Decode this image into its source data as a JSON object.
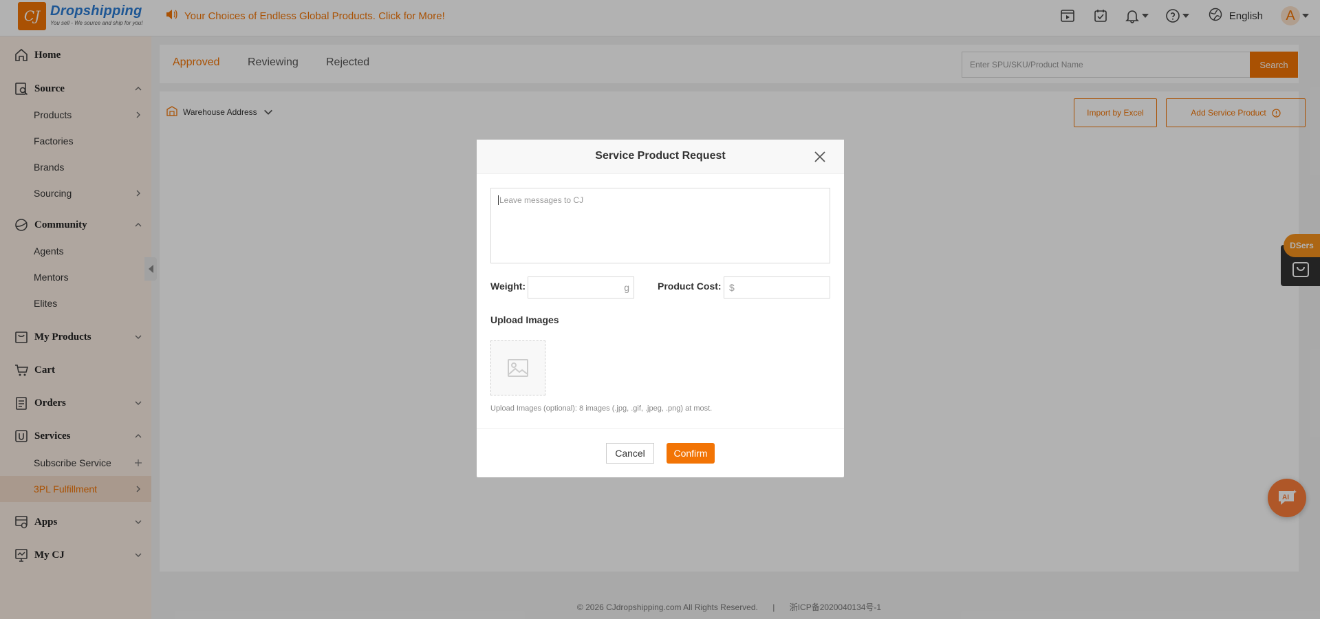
{
  "header": {
    "logo_text": "Dropshipping",
    "logo_mark": "CJ",
    "logo_tagline": "You sell - We source and ship for you!",
    "announcement": "Your Choices of Endless Global Products. Click for More!",
    "language": "English",
    "avatar_letter": "A",
    "icons": [
      "video-icon",
      "task-check-icon",
      "bell-icon",
      "help-icon",
      "globe-icon"
    ]
  },
  "sidebar": {
    "groups": [
      {
        "label": "Home",
        "icon": "home-icon"
      },
      {
        "label": "Source",
        "icon": "source-icon",
        "expanded": true,
        "items": [
          "Products",
          "Factories",
          "Brands",
          "Sourcing"
        ]
      },
      {
        "label": "Community",
        "icon": "community-icon",
        "expanded": true,
        "items": [
          "Agents",
          "Mentors",
          "Elites"
        ]
      },
      {
        "label": "My Products",
        "icon": "my-products-icon"
      },
      {
        "label": "Cart",
        "icon": "cart-icon"
      },
      {
        "label": "Orders",
        "icon": "orders-icon"
      },
      {
        "label": "Services",
        "icon": "services-icon",
        "expanded": true,
        "items": [
          "Subscribe Service",
          "3PL Fulfillment"
        ]
      },
      {
        "label": "Apps",
        "icon": "apps-icon"
      },
      {
        "label": "My CJ",
        "icon": "my-cj-icon"
      }
    ],
    "active_item": "3PL Fulfillment"
  },
  "tabs": {
    "items": [
      "Approved",
      "Reviewing",
      "Rejected"
    ],
    "active": "Approved"
  },
  "search": {
    "placeholder": "Enter SPU/SKU/Product Name",
    "button": "Search"
  },
  "toolbar": {
    "warehouse_label": "Warehouse Address",
    "import_button": "Import by Excel",
    "add_button": "Add Service Product"
  },
  "footer": {
    "copyright": "©  2026 CJdropshipping.com All Rights Reserved.",
    "separator": "|",
    "icp": "浙ICP备2020040134号-1"
  },
  "floating": {
    "dsers_label": "DSers",
    "ai_label": "AI"
  },
  "modal": {
    "title": "Service Product Request",
    "message_placeholder": "Leave messages to CJ",
    "weight_label": "Weight:",
    "weight_unit": "g",
    "cost_label": "Product Cost:",
    "cost_prefix": "$",
    "upload_label": "Upload Images",
    "upload_hint": "Upload Images (optional): 8 images (.jpg, .gif, .jpeg, .png) at most.",
    "cancel": "Cancel",
    "confirm": "Confirm"
  },
  "colors": {
    "accent": "#f27405",
    "sidebar_bg": "#fbeee4",
    "overlay": "rgba(0,0,0,0.3)"
  }
}
